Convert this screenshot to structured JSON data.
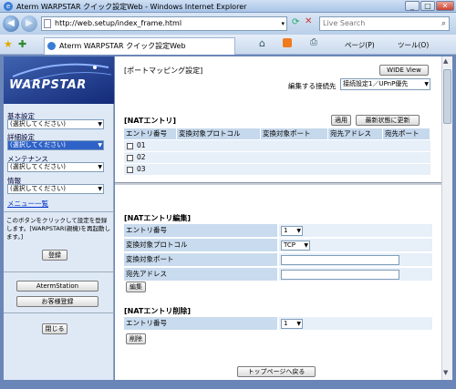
{
  "window": {
    "title": "Aterm WARPSTAR クイック設定Web - Windows Internet Explorer"
  },
  "address": {
    "url": "http://web.setup/index_frame.html"
  },
  "search": {
    "placeholder": "Live Search"
  },
  "tab": {
    "label": "Aterm WARPSTAR クイック設定Web"
  },
  "toolbar": {
    "page": "ページ(P)",
    "tools": "ツール(O)"
  },
  "sidebar": {
    "logo": "WARPSTAR",
    "groups": [
      {
        "label": "基本設定",
        "value": "(選択してください)"
      },
      {
        "label": "詳細設定",
        "value": "(選択してください)"
      },
      {
        "label": "メンテナンス",
        "value": "(選択してください)"
      },
      {
        "label": "情報",
        "value": "(選択してください)"
      }
    ],
    "menu_list": "メニュー一覧",
    "note": "このボタンをクリックして設定を登録します。[WARPSTAR(親機)を再起動します。]",
    "register": "登録",
    "aterm_station": "AtermStation",
    "customer_register": "お客様登録",
    "close": "閉じる"
  },
  "top": {
    "title": "[ポートマッピング設定]",
    "wide_view": "WIDE View",
    "connection_label": "編集する接続先",
    "connection_value": "接続設定1／UPnP優先"
  },
  "nat": {
    "title": "[NATエントリ]",
    "apply": "適用",
    "refresh": "最新状態に更新",
    "headers": [
      "エントリ番号",
      "変換対象プロトコル",
      "変換対象ポート",
      "宛先アドレス",
      "宛先ポート"
    ],
    "rows": [
      "01",
      "02",
      "03"
    ]
  },
  "edit": {
    "title": "[NATエントリ編集]",
    "entry_label": "エントリ番号",
    "entry_value": "1",
    "protocol_label": "変換対象プロトコル",
    "protocol_value": "TCP",
    "port_label": "変換対象ポート",
    "port_value": "",
    "dest_label": "宛先アドレス",
    "dest_value": "",
    "button": "編集"
  },
  "delete": {
    "title": "[NATエントリ削除]",
    "entry_label": "エントリ番号",
    "entry_value": "1",
    "button": "削除"
  },
  "footer": {
    "top_page": "トップページへ戻る"
  }
}
